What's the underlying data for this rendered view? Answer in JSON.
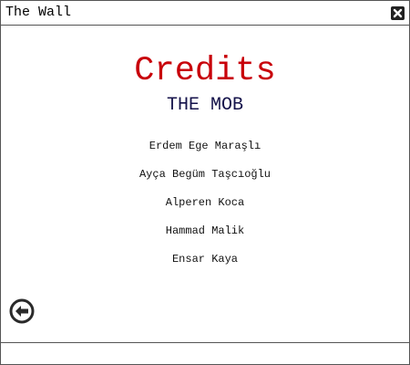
{
  "window": {
    "title": "The Wall"
  },
  "credits": {
    "heading": "Credits",
    "team": "THE MOB",
    "members": [
      "Erdem Ege Maraşlı",
      "Ayça Begüm Taşcıoğlu",
      "Alperen Koca",
      "Hammad Malik",
      "Ensar Kaya"
    ]
  },
  "icons": {
    "close": "close-icon",
    "back": "back-arrow-icon"
  },
  "colors": {
    "heading": "#c8000a",
    "team": "#14124a",
    "text": "#111111"
  }
}
